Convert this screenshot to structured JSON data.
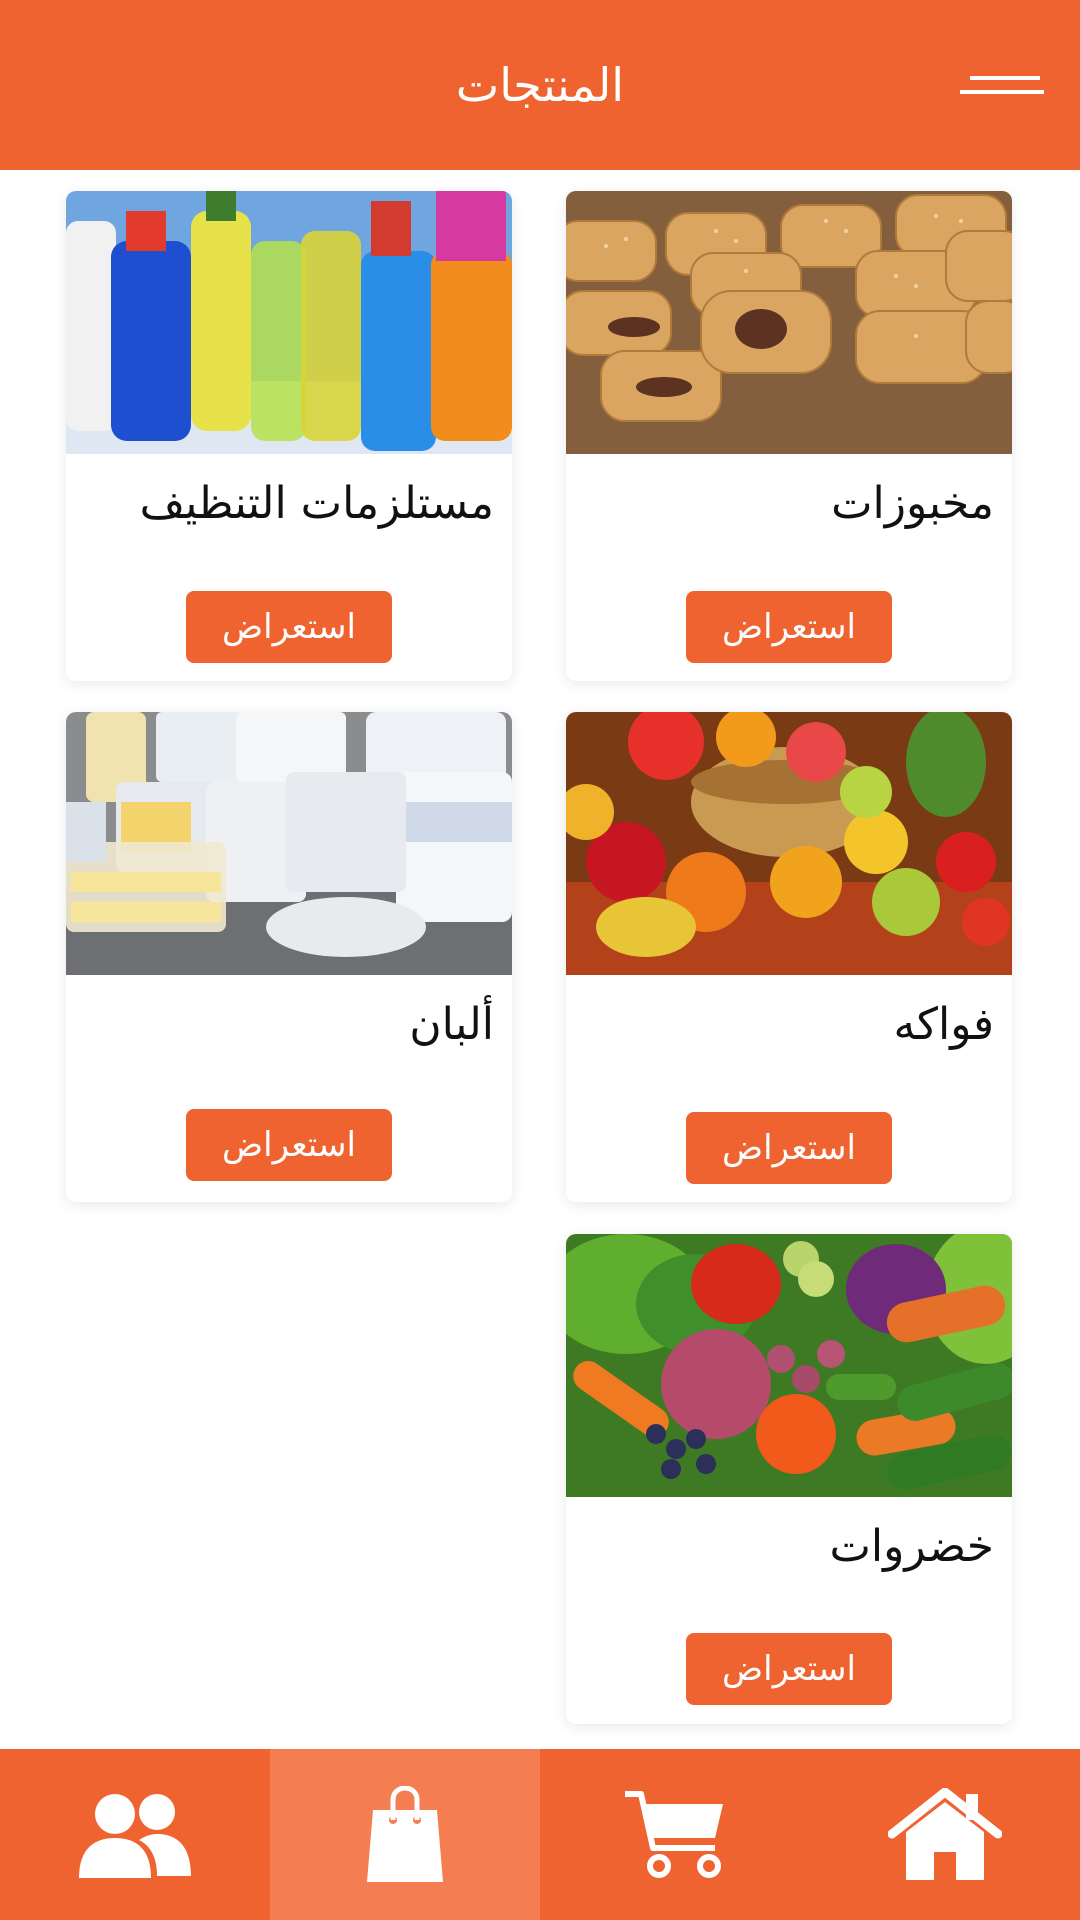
{
  "header": {
    "title": "المنتجات",
    "menu_icon": "hamburger-menu-icon"
  },
  "products": [
    {
      "name": "مخبوزات",
      "button_label": "استعراض",
      "image": "baked-goods-photo"
    },
    {
      "name": "مستلزمات التنظيف",
      "button_label": "استعراض",
      "image": "cleaning-supplies-photo"
    },
    {
      "name": "فواكه",
      "button_label": "استعراض",
      "image": "fruits-photo"
    },
    {
      "name": "ألبان",
      "button_label": "استعراض",
      "image": "dairy-products-photo"
    },
    {
      "name": "خضروات",
      "button_label": "استعراض",
      "image": "vegetables-photo"
    }
  ],
  "bottom_nav": {
    "items": [
      {
        "icon": "home-icon",
        "active": false
      },
      {
        "icon": "cart-icon",
        "active": false
      },
      {
        "icon": "shopping-bag-icon",
        "active": true
      },
      {
        "icon": "users-icon",
        "active": false
      }
    ]
  },
  "colors": {
    "primary": "#ef6330",
    "active_tab": "#f47e52",
    "background": "#ffffff",
    "text": "#111111"
  }
}
